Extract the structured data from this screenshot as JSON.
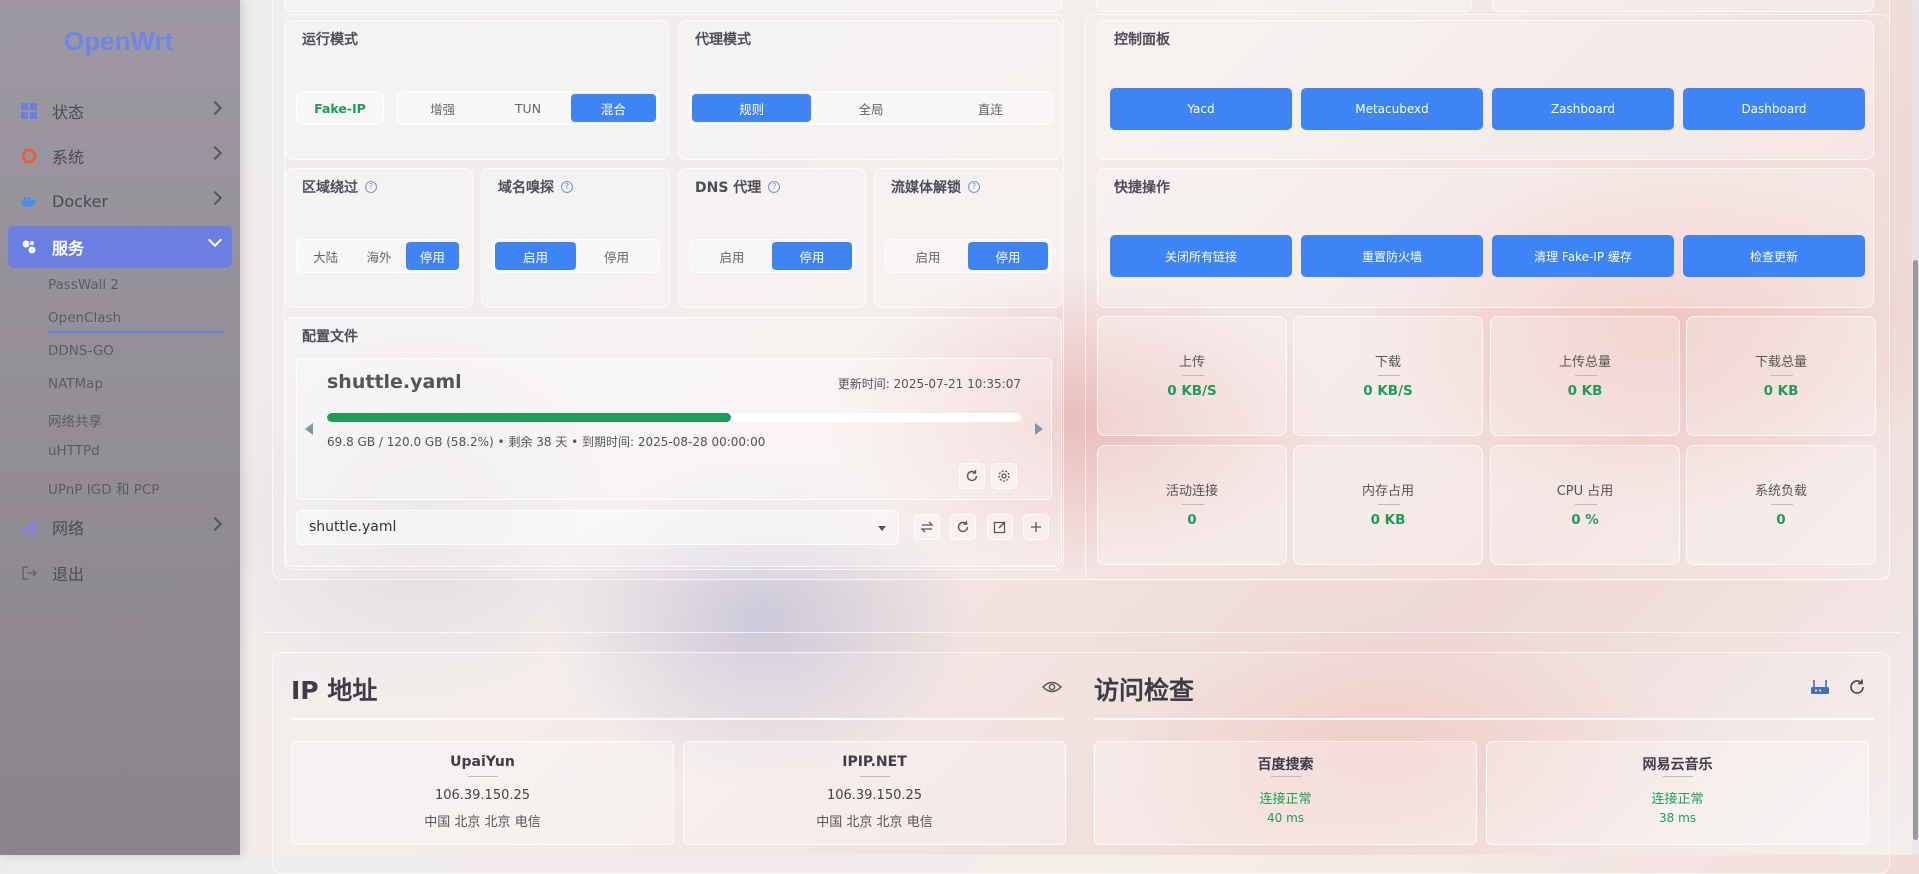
{
  "brand": {
    "logo": "OpenWrt"
  },
  "sidebar": {
    "items": [
      {
        "label": "状态",
        "icon": "dashboard-icon"
      },
      {
        "label": "系统",
        "icon": "gear-icon"
      },
      {
        "label": "Docker",
        "icon": "docker-icon"
      },
      {
        "label": "服务",
        "icon": "services-icon"
      },
      {
        "label": "网络",
        "icon": "network-icon"
      },
      {
        "label": "退出",
        "icon": "logout-icon"
      }
    ],
    "sub_items": [
      "PassWall 2",
      "OpenClash",
      "DDNS-GO",
      "NATMap",
      "网络共享",
      "uHTTPd",
      "UPnP IGD 和 PCP"
    ]
  },
  "run_mode": {
    "title": "运行模式",
    "fake_ip": "Fake-IP",
    "options": [
      "增强",
      "TUN",
      "混合"
    ],
    "selected": "混合"
  },
  "proxy_mode": {
    "title": "代理模式",
    "options": [
      "规则",
      "全局",
      "直连"
    ],
    "selected": "规则"
  },
  "toggles": [
    {
      "title": "区域绕过",
      "options": [
        "大陆",
        "海外",
        "停用"
      ],
      "selected": "停用"
    },
    {
      "title": "域名嗅探",
      "options": [
        "启用",
        "停用"
      ],
      "selected": "启用"
    },
    {
      "title": "DNS 代理",
      "options": [
        "启用",
        "停用"
      ],
      "selected": "停用"
    },
    {
      "title": "流媒体解锁",
      "options": [
        "启用",
        "停用"
      ],
      "selected": "停用"
    }
  ],
  "config": {
    "title": "配置文件",
    "filename": "shuttle.yaml",
    "updated": "更新时间: 2025-07-21 10:35:07",
    "usage_fraction": 0.582,
    "usage_text": "69.8 GB / 120.0 GB (58.2%) • 剩余 38 天 • 到期时间: 2025-08-28 00:00:00",
    "select_value": "shuttle.yaml"
  },
  "control_panel": {
    "title": "控制面板",
    "buttons": [
      "Yacd",
      "Metacubexd",
      "Zashboard",
      "Dashboard"
    ]
  },
  "quick_actions": {
    "title": "快捷操作",
    "buttons": [
      "关闭所有链接",
      "重置防火墙",
      "清理 Fake-IP 缓存",
      "检查更新"
    ]
  },
  "stats": [
    {
      "label": "上传",
      "value": "0 KB/S"
    },
    {
      "label": "下载",
      "value": "0 KB/S"
    },
    {
      "label": "上传总量",
      "value": "0 KB"
    },
    {
      "label": "下载总量",
      "value": "0 KB"
    },
    {
      "label": "活动连接",
      "value": "0"
    },
    {
      "label": "内存占用",
      "value": "0 KB"
    },
    {
      "label": "CPU 占用",
      "value": "0 %"
    },
    {
      "label": "系统负载",
      "value": "0"
    }
  ],
  "ip_section": {
    "title": "IP 地址",
    "cards": [
      {
        "name": "UpaiYun",
        "ip": "106.39.150.25",
        "location": "中国 北京 北京 电信"
      },
      {
        "name": "IPIP.NET",
        "ip": "106.39.150.25",
        "location": "中国 北京 北京 电信"
      }
    ]
  },
  "access_check": {
    "title": "访问检查",
    "cards": [
      {
        "name": "百度搜索",
        "status": "连接正常",
        "latency": "40 ms"
      },
      {
        "name": "网易云音乐",
        "status": "连接正常",
        "latency": "38 ms"
      }
    ]
  },
  "colors": {
    "accent": "#3f84f5",
    "success": "#1f9d55",
    "brand": "#6a7fe2"
  }
}
